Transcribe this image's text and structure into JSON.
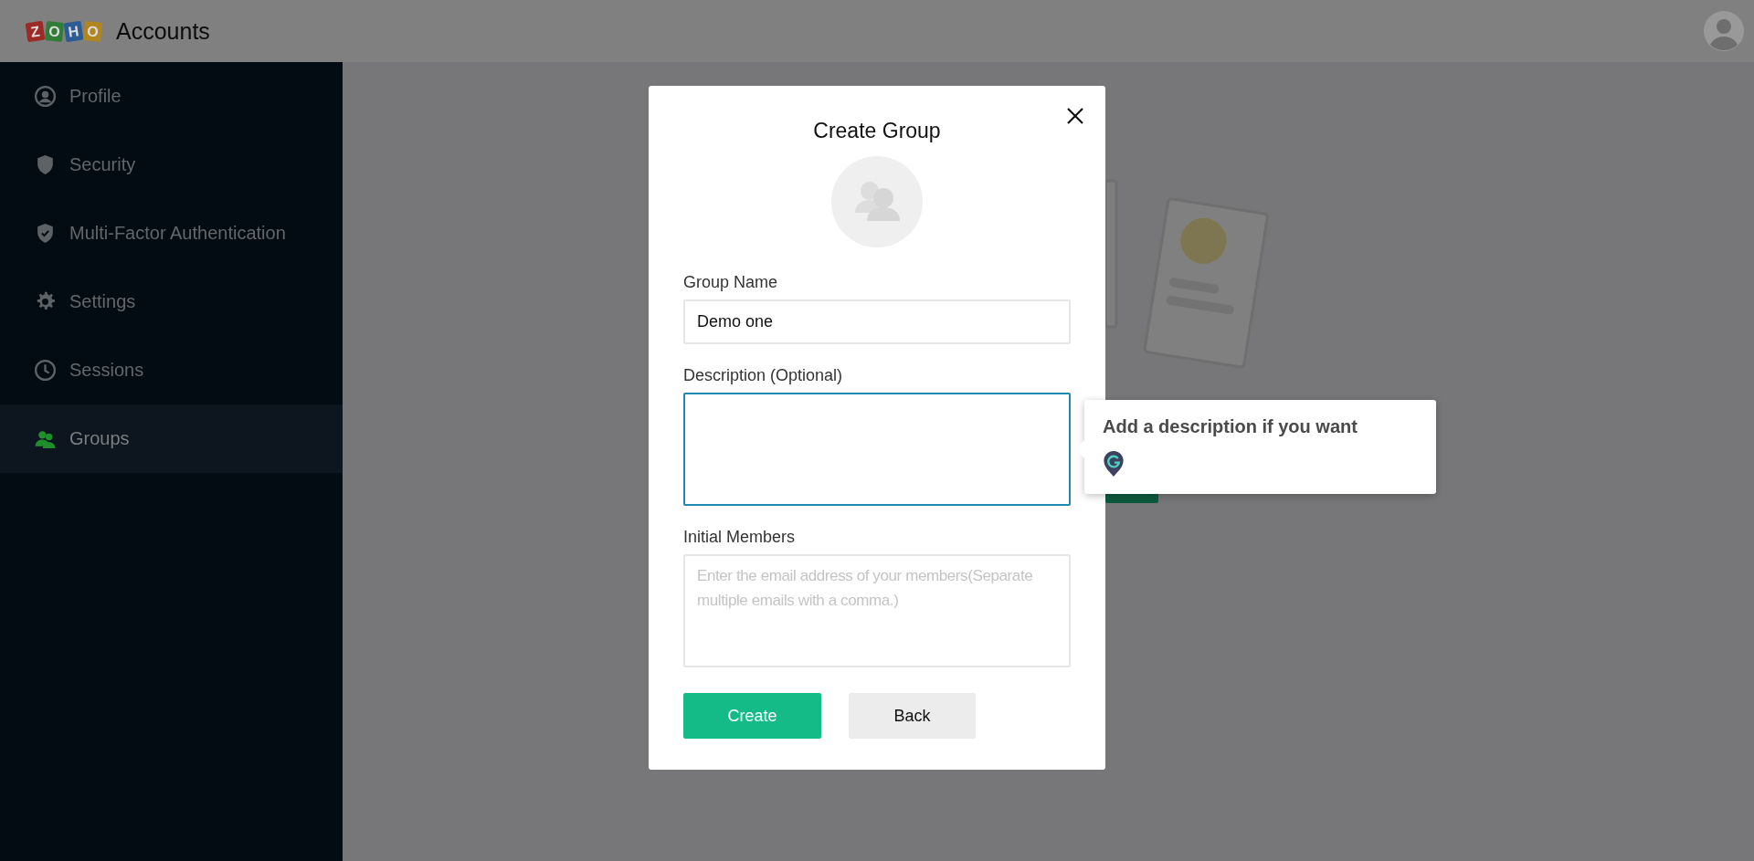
{
  "header": {
    "logo_letters": [
      {
        "text": "Z",
        "color": "#9c2b27"
      },
      {
        "text": "O",
        "color": "#2f7d37"
      },
      {
        "text": "H",
        "color": "#2b5c94"
      },
      {
        "text": "O",
        "color": "#b2861f"
      }
    ],
    "title": "Accounts"
  },
  "sidebar": {
    "items": [
      {
        "label": "Profile",
        "selected": false
      },
      {
        "label": "Security",
        "selected": false
      },
      {
        "label": "Multi-Factor Authentication",
        "selected": false
      },
      {
        "label": "Settings",
        "selected": false
      },
      {
        "label": "Sessions",
        "selected": false
      },
      {
        "label": "Groups",
        "selected": true
      }
    ]
  },
  "dialog": {
    "title": "Create Group",
    "fields": [
      {
        "label": "Group Name",
        "kind": "text",
        "value": "Demo one",
        "focused": false
      },
      {
        "label": "Description (Optional)",
        "kind": "textarea",
        "focused": true
      },
      {
        "label": "Initial Members",
        "kind": "textarea",
        "placeholder": "Enter the email address of your members(Separate multiple emails with a comma.)",
        "focused": false
      }
    ],
    "buttons": [
      {
        "label": "Create",
        "kind": "primary"
      },
      {
        "label": "Back",
        "kind": "secondary"
      }
    ]
  },
  "tooltip": {
    "text": "Add a description if you want"
  }
}
